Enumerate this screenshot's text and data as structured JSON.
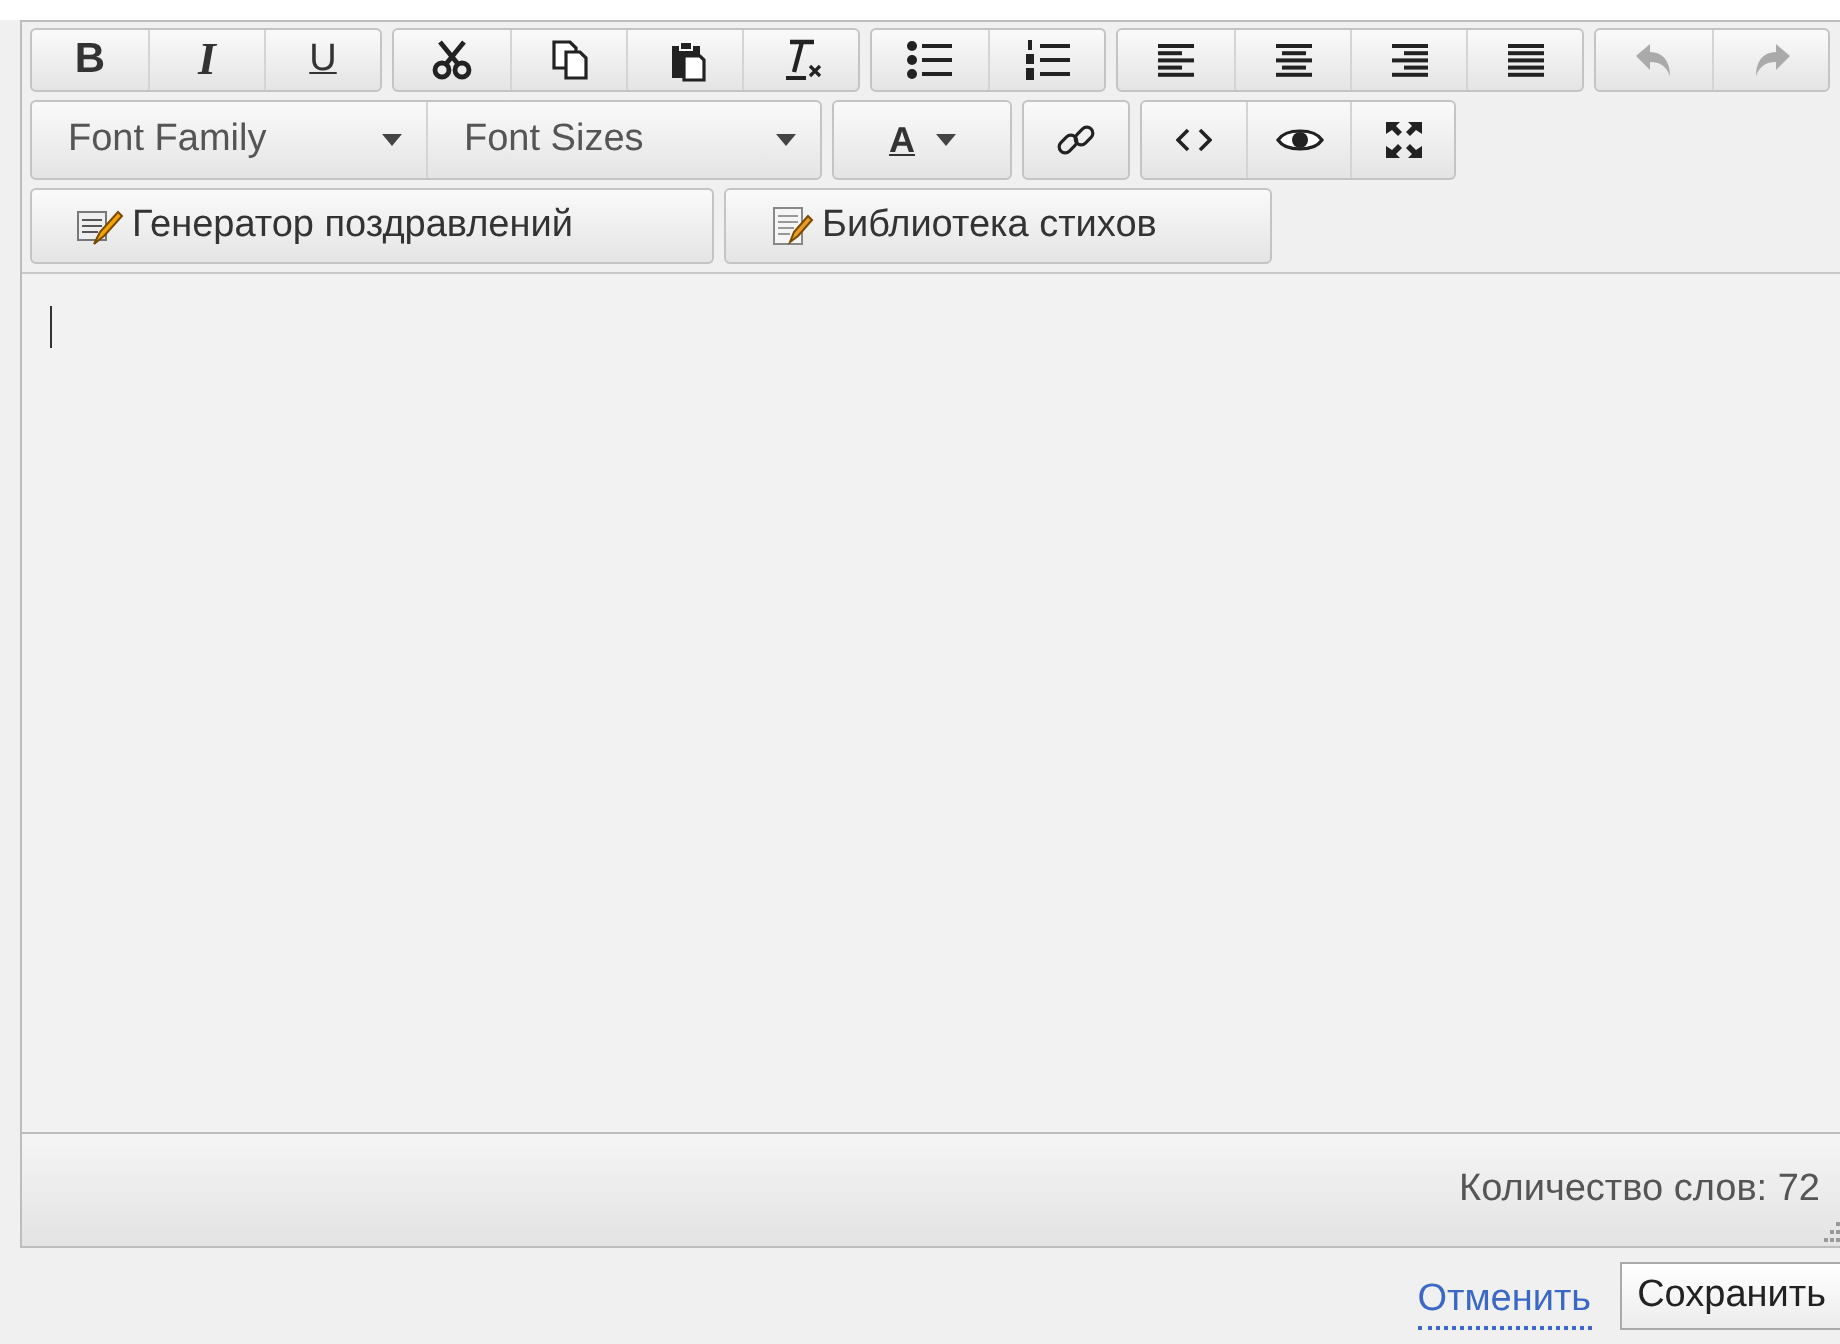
{
  "toolbar": {
    "rows": [
      {
        "groups": [
          [
            {
              "kind": "bold",
              "label": "B",
              "disabled": false
            },
            {
              "kind": "italic",
              "label": "I",
              "disabled": false
            },
            {
              "kind": "underline",
              "label": "U",
              "disabled": false
            }
          ],
          [
            {
              "kind": "cut",
              "disabled": false
            },
            {
              "kind": "copy",
              "disabled": false
            },
            {
              "kind": "paste",
              "disabled": false
            },
            {
              "kind": "clear-format",
              "disabled": false
            }
          ],
          [
            {
              "kind": "bullet-list",
              "disabled": false
            },
            {
              "kind": "numbered-list",
              "disabled": false
            }
          ],
          [
            {
              "kind": "align-left",
              "disabled": false
            },
            {
              "kind": "align-center",
              "disabled": false
            },
            {
              "kind": "align-right",
              "disabled": false
            },
            {
              "kind": "justify",
              "disabled": false
            }
          ],
          [
            {
              "kind": "undo",
              "disabled": true
            },
            {
              "kind": "redo",
              "disabled": true
            }
          ]
        ]
      },
      {
        "groups": [
          [
            {
              "kind": "dropdown",
              "label": "Font Family"
            },
            {
              "kind": "dropdown",
              "label": "Font Sizes"
            }
          ],
          [
            {
              "kind": "text-color",
              "label": "A"
            }
          ],
          [
            {
              "kind": "link",
              "disabled": false
            }
          ],
          [
            {
              "kind": "code",
              "disabled": false
            },
            {
              "kind": "preview",
              "disabled": false
            },
            {
              "kind": "fullscreen",
              "disabled": false
            }
          ]
        ]
      },
      {
        "groups": [
          [
            {
              "kind": "pen",
              "label": "Генератор поздравлений"
            }
          ],
          [
            {
              "kind": "notepad",
              "label": "Библиотека стихов"
            }
          ]
        ]
      }
    ]
  },
  "status_bar": {
    "word_count": "Количество слов: 72"
  },
  "actions": {
    "cancel": "Отменить",
    "save": "Сохранить"
  }
}
